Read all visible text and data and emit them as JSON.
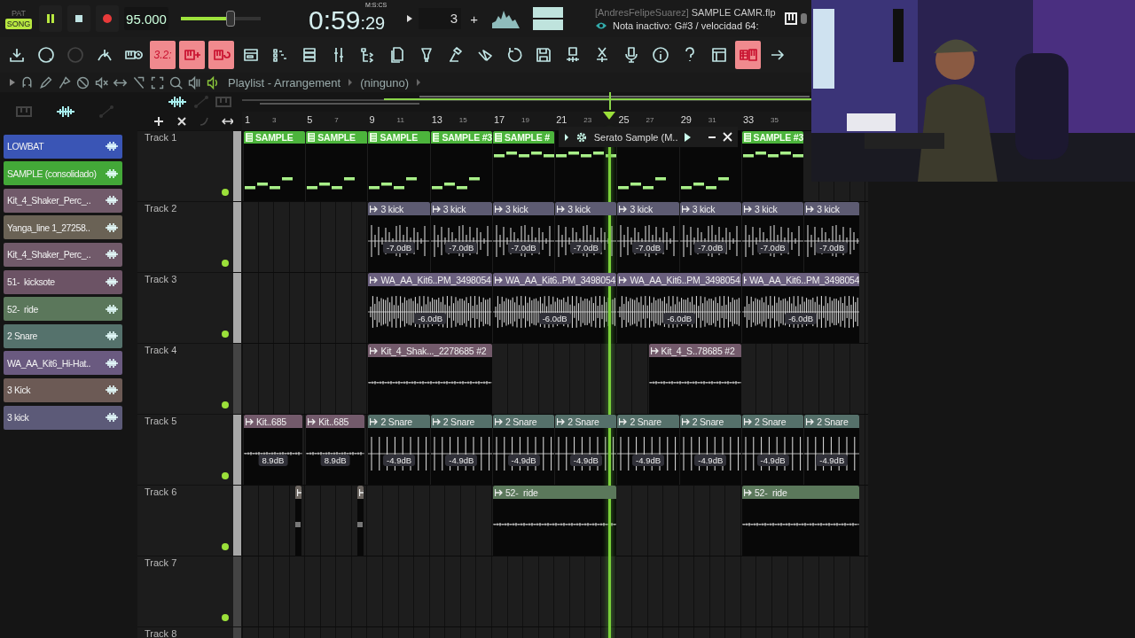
{
  "transport": {
    "modes": [
      {
        "label": "PAT",
        "selected": false
      },
      {
        "label": "SONG",
        "selected": true
      }
    ],
    "playing": true,
    "tempo": "95.000",
    "master": {
      "level": 0.62
    },
    "time": {
      "main": "0:59",
      "sub": ":29",
      "unit": "M:S:CS"
    },
    "pattern": {
      "value": "3",
      "add": "+"
    }
  },
  "title": {
    "user": "[AndresFelipeSuarez]",
    "file": "SAMPLE CAMR.flp",
    "hint": "Nota inactivo: G#3 / velocidad 64:"
  },
  "toolbar": [
    {
      "kind": "download",
      "on": false
    },
    {
      "kind": "knob",
      "on": false
    },
    {
      "kind": "knob-dark",
      "on": false
    },
    {
      "kind": "metronome",
      "on": false
    },
    {
      "kind": "typing",
      "on": false
    },
    {
      "kind": "countdown",
      "label": "3.2:",
      "on": true
    },
    {
      "kind": "step",
      "on": true
    },
    {
      "kind": "loop",
      "on": true
    },
    {
      "kind": "playlist",
      "on": false
    },
    {
      "kind": "rack",
      "on": false
    },
    {
      "kind": "list",
      "on": false
    },
    {
      "kind": "mixer",
      "on": false
    },
    {
      "kind": "browser",
      "on": false
    },
    {
      "kind": "docs",
      "on": false
    },
    {
      "kind": "plug",
      "on": false
    },
    {
      "kind": "hammer",
      "on": false
    },
    {
      "kind": "hand",
      "on": false
    },
    {
      "kind": "undo",
      "on": false
    },
    {
      "kind": "save",
      "on": false
    },
    {
      "kind": "saveaudio",
      "on": false
    },
    {
      "kind": "cut",
      "on": false
    },
    {
      "kind": "mic",
      "on": false
    },
    {
      "kind": "info",
      "on": false
    },
    {
      "kind": "help",
      "on": false
    },
    {
      "kind": "window",
      "on": false
    },
    {
      "kind": "pianogrid",
      "on": true
    },
    {
      "kind": "arrow",
      "on": false
    }
  ],
  "playlist": {
    "title": "Playlist - Arrangement",
    "pattern": "(ninguno)",
    "ruler": [
      {
        "label": "1",
        "major": true
      },
      {
        "label": "3",
        "major": false
      },
      {
        "label": "5",
        "major": true
      },
      {
        "label": "7",
        "major": false
      },
      {
        "label": "9",
        "major": true
      },
      {
        "label": "11",
        "major": false
      },
      {
        "label": "13",
        "major": true
      },
      {
        "label": "15",
        "major": false
      },
      {
        "label": "17",
        "major": true
      },
      {
        "label": "19",
        "major": false
      },
      {
        "label": "21",
        "major": true
      },
      {
        "label": "23",
        "major": false
      },
      {
        "label": "25",
        "major": true
      },
      {
        "label": "27",
        "major": false
      },
      {
        "label": "29",
        "major": true
      },
      {
        "label": "31",
        "major": false
      },
      {
        "label": "33",
        "major": true
      },
      {
        "label": "35",
        "major": false
      }
    ],
    "tracks": [
      {
        "name": "Track 1",
        "selected": true,
        "enabled": true,
        "clips": [
          {
            "kind": "pattern",
            "label": "SAMPLE"
          },
          {
            "kind": "pattern",
            "label": "SAMPLE"
          },
          {
            "kind": "pattern",
            "label": "SAMPLE"
          },
          {
            "kind": "pattern",
            "label": "SAMPLE #3"
          },
          {
            "kind": "pattern",
            "label": "SAMPLE #"
          },
          {
            "kind": "pattern"
          },
          {
            "kind": "pattern"
          },
          {
            "kind": "pattern"
          },
          {
            "kind": "pattern",
            "label": "SAMPLE #3"
          }
        ]
      },
      {
        "name": "Track 2",
        "selected": true,
        "enabled": true,
        "clips": [
          {
            "kind": "spiky",
            "label": "3 kick",
            "volume": "-7.0dB",
            "color": "#5d5b72"
          },
          {
            "kind": "spiky",
            "label": "3 kick",
            "volume": "-7.0dB",
            "color": "#5d5b72"
          },
          {
            "kind": "spiky",
            "label": "3 kick",
            "volume": "-7.0dB",
            "color": "#5d5b72"
          },
          {
            "kind": "spiky",
            "label": "3 kick",
            "volume": "-7.0dB",
            "color": "#5d5b72"
          },
          {
            "kind": "spiky",
            "label": "3 kick",
            "volume": "-7.0dB",
            "color": "#5d5b72"
          },
          {
            "kind": "spiky",
            "label": "3 kick",
            "volume": "-7.0dB",
            "color": "#5d5b72"
          },
          {
            "kind": "spiky",
            "label": "3 kick",
            "volume": "-7.0dB",
            "color": "#5d5b72"
          },
          {
            "kind": "spiky",
            "label": "3 kick",
            "volume": "-7.0dB",
            "color": "#5d5b72"
          }
        ]
      },
      {
        "name": "Track 3",
        "selected": true,
        "enabled": true,
        "clips": [
          {
            "kind": "dense",
            "label": "WA_AA_Kit6..PM_3498054",
            "volume": "-6.0dB",
            "color": "#6a5f7e"
          },
          {
            "kind": "dense",
            "label": "WA_AA_Kit6..PM_3498054",
            "volume": "-6.0dB",
            "color": "#6a5f7e"
          },
          {
            "kind": "dense",
            "label": "WA_AA_Kit6..PM_3498054",
            "volume": "-6.0dB",
            "color": "#6a5f7e"
          },
          {
            "kind": "dense",
            "label": "WA_AA_Kit6..PM_3498054",
            "volume": "-6.0dB",
            "color": "#6a5f7e"
          }
        ]
      },
      {
        "name": "Track 4",
        "selected": false,
        "enabled": true,
        "clips": [
          {
            "kind": "flat",
            "label": "Kit_4_Shak..._2278685 #2",
            "color": "#735a6b"
          },
          {
            "kind": "flat",
            "label": "Kit_4_S..78685 #2",
            "color": "#735a6b"
          }
        ]
      },
      {
        "name": "Track 5",
        "selected": true,
        "enabled": true,
        "clips": [
          {
            "kind": "flat",
            "label": "Kit..685",
            "volume": "8.9dB",
            "color": "#735a6b"
          },
          {
            "kind": "flat",
            "label": "Kit..685",
            "volume": "8.9dB",
            "color": "#735a6b"
          },
          {
            "kind": "regular",
            "label": "2 Snare",
            "volume": "-4.9dB",
            "color": "#55706a"
          },
          {
            "kind": "regular",
            "label": "2 Snare",
            "volume": "-4.9dB",
            "color": "#55706a"
          },
          {
            "kind": "regular",
            "label": "2 Snare",
            "volume": "-4.9dB",
            "color": "#55706a"
          },
          {
            "kind": "regular",
            "label": "2 Snare",
            "volume": "-4.9dB",
            "color": "#55706a"
          },
          {
            "kind": "regular",
            "label": "2 Snare",
            "volume": "-4.9dB",
            "color": "#55706a"
          },
          {
            "kind": "regular",
            "label": "2 Snare",
            "volume": "-4.9dB",
            "color": "#55706a"
          },
          {
            "kind": "regular",
            "label": "2 Snare",
            "volume": "-4.9dB",
            "color": "#55706a"
          },
          {
            "kind": "regular",
            "label": "2 Snare",
            "volume": "-4.9dB",
            "color": "#55706a"
          }
        ]
      },
      {
        "name": "Track 6",
        "selected": true,
        "enabled": true,
        "clips": [
          {
            "kind": "short",
            "color": "#6b6560"
          },
          {
            "kind": "short",
            "color": "#6b6560"
          },
          {
            "kind": "flat",
            "label": "52-  ride",
            "color": "#5b785b"
          },
          {
            "kind": "flat",
            "label": "52-  ride",
            "color": "#5b785b"
          }
        ]
      },
      {
        "name": "Track 7",
        "selected": false,
        "enabled": true
      },
      {
        "name": "Track 8",
        "selected": false
      }
    ]
  },
  "channels": [
    {
      "label": "LOWBAT",
      "color": "#3a55b5"
    },
    {
      "label": "SAMPLE (consolidado)",
      "color": "#43a838"
    },
    {
      "label": "Kit_4_Shaker_Perc_..",
      "color": "#715a6a"
    },
    {
      "label": "Yanga_line 1_27258..",
      "color": "#6a6255"
    },
    {
      "label": "Kit_4_Shaker_Perc_..",
      "color": "#715a6a"
    },
    {
      "label": "51-  kicksote",
      "color": "#6c5365"
    },
    {
      "label": "52-  ride",
      "color": "#5b775b"
    },
    {
      "label": "2 Snare",
      "color": "#55726c"
    },
    {
      "label": "WA_AA_Kit6_Hi-Hat..",
      "color": "#6a5a80"
    },
    {
      "label": "3 Kick",
      "color": "#6c5a55"
    },
    {
      "label": "3 kick",
      "color": "#5c5a78"
    }
  ],
  "popup": {
    "title": "Serato Sample (M.."
  }
}
